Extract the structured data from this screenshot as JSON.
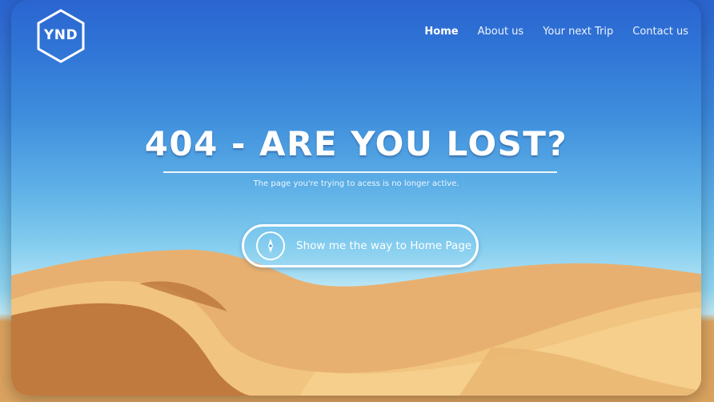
{
  "brand": {
    "logo_text": "YND"
  },
  "nav": {
    "items": [
      {
        "label": "Home",
        "active": true
      },
      {
        "label": "About us",
        "active": false
      },
      {
        "label": "Your next Trip",
        "active": false
      },
      {
        "label": "Contact us",
        "active": false
      }
    ]
  },
  "hero": {
    "title": "404 - ARE YOU LOST?",
    "subtitle": "The page you're trying to acess is no longer active.",
    "cta_label": "Show me the way to Home Page",
    "cta_icon": "compass-icon"
  },
  "colors": {
    "sky_top": "#2b65d0",
    "sky_bottom": "#c7ecf7",
    "sand": "#e3a85f",
    "text": "#ffffff"
  }
}
